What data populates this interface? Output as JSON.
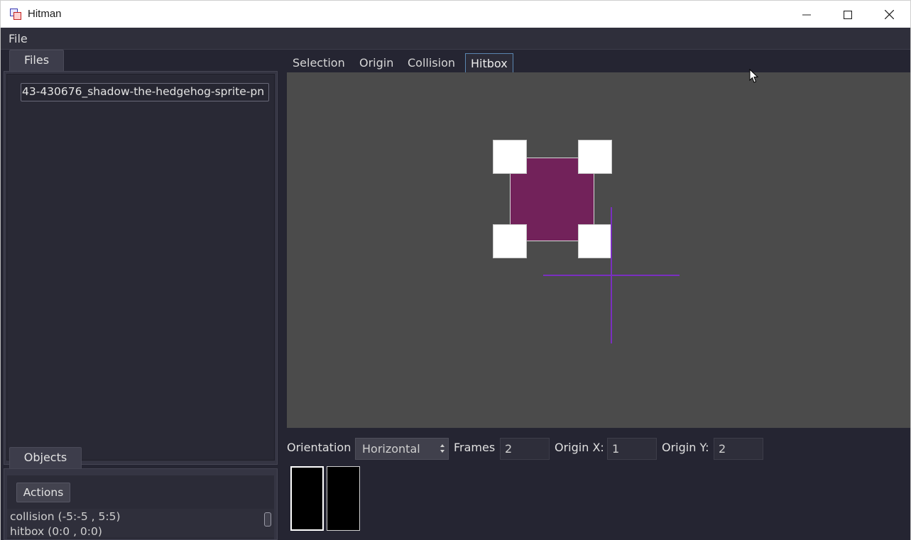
{
  "window": {
    "title": "Hitman",
    "controls": {
      "minimize": "minimize-icon",
      "maximize": "maximize-icon",
      "close": "close-icon"
    }
  },
  "menubar": {
    "items": [
      {
        "label": "File"
      }
    ]
  },
  "left_panel": {
    "files_tab": "Files",
    "files": [
      {
        "name": "43-430676_shadow-the-hedgehog-sprite-pn"
      }
    ],
    "objects_tab": "Objects",
    "actions_button": "Actions",
    "objects": [
      {
        "label": "collision (-5:-5 , 5:5)"
      },
      {
        "label": "hitbox (0:0 , 0:0)"
      }
    ]
  },
  "editor": {
    "tabs": [
      {
        "label": "Selection",
        "active": false
      },
      {
        "label": "Origin",
        "active": false
      },
      {
        "label": "Collision",
        "active": false
      },
      {
        "label": "Hitbox",
        "active": true
      }
    ],
    "colors": {
      "hitbox_fill": "#72225a",
      "origin_cross": "#7a2fc0",
      "canvas_bg": "#4b4b4b"
    },
    "controls": {
      "orientation_label": "Orientation",
      "orientation_value": "Horizontal",
      "frames_label": "Frames",
      "frames_value": "2",
      "origin_x_label": "Origin X:",
      "origin_x_value": "1",
      "origin_y_label": "Origin Y:",
      "origin_y_value": "2"
    },
    "frame_thumbnails": [
      {
        "selected": true
      },
      {
        "selected": false
      }
    ]
  }
}
